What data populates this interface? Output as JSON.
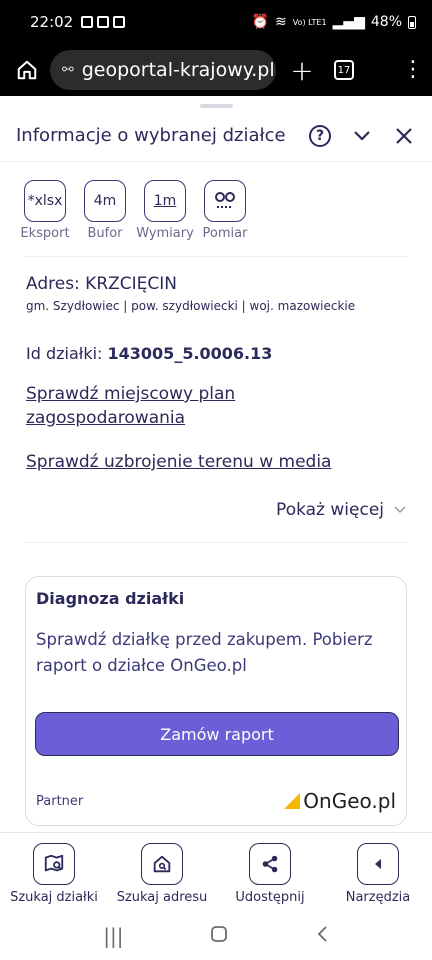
{
  "status": {
    "time": "22:02",
    "battery": "48%",
    "network": "Vo) LTE1"
  },
  "browser": {
    "url": "geoportal-krajowy.pl/r",
    "tab_count": "17"
  },
  "panel": {
    "title": "Informacje o wybranej działce",
    "tools": [
      {
        "icon_text": "*xlsx",
        "label": "Eksport"
      },
      {
        "icon_text": "4m",
        "label": "Bufor"
      },
      {
        "icon_text": "1m",
        "label": "Wymiary"
      },
      {
        "icon_text": "",
        "label": "Pomiar"
      }
    ],
    "address_title": "Adres: KRZCIĘCIN",
    "address_sub": "gm. Szydłowiec | pow. szydłowiecki | woj. mazowieckie",
    "parcel_label": "Id działki:",
    "parcel_id": "143005_5.0006.13",
    "link_plan": "Sprawdź miejscowy plan zagospodarowania",
    "link_media": "Sprawdź uzbrojenie terenu w media",
    "show_more": "Pokaż więcej"
  },
  "card": {
    "title": "Diagnoza działki",
    "description": "Sprawdź działkę przed zakupem. Pobierz raport o działce OnGeo.pl",
    "button": "Zamów raport",
    "partner_label": "Partner",
    "partner_brand": "OnGeo.pl"
  },
  "bottom_nav": [
    {
      "label": "Szukaj działki"
    },
    {
      "label": "Szukaj adresu"
    },
    {
      "label": "Udostępnij"
    },
    {
      "label": "Narzędzia"
    }
  ],
  "colors": {
    "primary": "#2b2a5a",
    "accent_button": "#6b5ed6",
    "brand_mark": "#f5b800"
  }
}
